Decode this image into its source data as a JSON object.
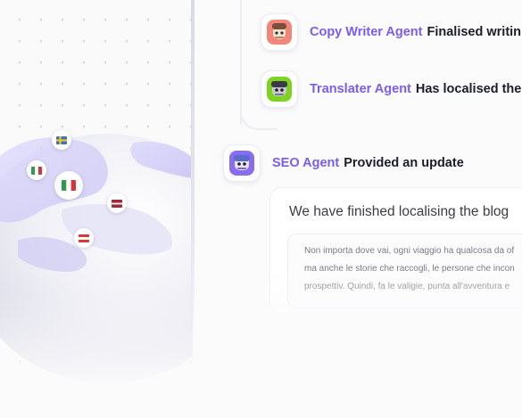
{
  "timeline": {
    "items": [
      {
        "agent": "Copy Writer Agent",
        "action": "Finalised writin",
        "avatar_bg": "#f4857a",
        "icon": "robot-avatar-icon"
      },
      {
        "agent": "Translater Agent",
        "action": "Has localised the",
        "avatar_bg": "#7ed321",
        "icon": "robot-avatar-icon"
      },
      {
        "agent": "SEO Agent",
        "action": "Provided an update",
        "avatar_bg": "#8a6cf0",
        "icon": "robot-avatar-icon"
      }
    ]
  },
  "message": {
    "title": "We have finished localising the blog",
    "quote_lines": [
      "Non importa dove vai, ogni viaggio ha qualcosa da of",
      "ma anche le storie che raccogli, le persone che incon",
      "prospettiv. Quindi, fa le valigie, punta all'avventura e"
    ]
  },
  "globe": {
    "flags": [
      "sweden-flag-icon",
      "italy-flag-icon",
      "italy-flag-icon",
      "latvia-flag-icon",
      "austria-flag-icon"
    ]
  },
  "colors": {
    "accent": "#7b5cf0",
    "text_dark": "#1c1d2b"
  }
}
